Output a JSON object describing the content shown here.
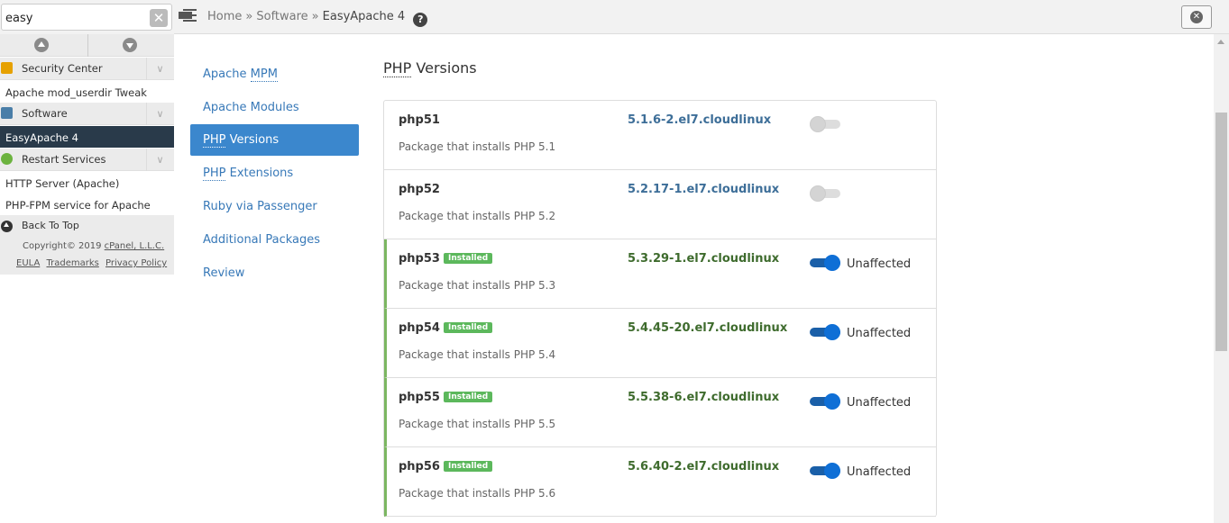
{
  "sidebar": {
    "search": {
      "value": "easy",
      "placeholder": ""
    },
    "categories": [
      {
        "label": "Security Center",
        "icon": "lock-icon"
      },
      {
        "label": "Software",
        "icon": "software-icon"
      },
      {
        "label": "Restart Services",
        "icon": "restart-icon"
      }
    ],
    "items": [
      {
        "label": "Apache mod_userdir Tweak"
      },
      {
        "label": "EasyApache 4"
      },
      {
        "label": "HTTP Server (Apache)"
      },
      {
        "label": "PHP-FPM service for Apache"
      }
    ],
    "back_to_top": "Back To Top",
    "footer": {
      "copyright": "Copyright© 2019 ",
      "company": "cPanel, L.L.C.",
      "links": [
        "EULA",
        "Trademarks",
        "Privacy Policy"
      ]
    }
  },
  "topbar": {
    "breadcrumb": [
      "Home",
      "Software",
      "EasyApache 4"
    ],
    "separator": "»",
    "help": "?"
  },
  "nav": {
    "items": [
      {
        "abbr": "Apache ",
        "abbr_part": "MPM",
        "rest": ""
      },
      {
        "label": "Apache Modules"
      },
      {
        "abbr_part": "PHP",
        "rest": " Versions"
      },
      {
        "abbr_part": "PHP",
        "rest": " Extensions"
      },
      {
        "label": "Ruby via Passenger"
      },
      {
        "label": "Additional Packages"
      },
      {
        "label": "Review"
      }
    ],
    "active_index": 2
  },
  "main": {
    "title_abbr": "PHP",
    "title_rest": " Versions",
    "installed_badge": "Installed",
    "packages": [
      {
        "name": "php51",
        "version": "5.1.6-2.el7.cloudlinux",
        "description": "Package that installs PHP 5.1",
        "installed": false,
        "enabled": false,
        "status": ""
      },
      {
        "name": "php52",
        "version": "5.2.17-1.el7.cloudlinux",
        "description": "Package that installs PHP 5.2",
        "installed": false,
        "enabled": false,
        "status": ""
      },
      {
        "name": "php53",
        "version": "5.3.29-1.el7.cloudlinux",
        "description": "Package that installs PHP 5.3",
        "installed": true,
        "enabled": true,
        "status": "Unaffected"
      },
      {
        "name": "php54",
        "version": "5.4.45-20.el7.cloudlinux",
        "description": "Package that installs PHP 5.4",
        "installed": true,
        "enabled": true,
        "status": "Unaffected"
      },
      {
        "name": "php55",
        "version": "5.5.38-6.el7.cloudlinux",
        "description": "Package that installs PHP 5.5",
        "installed": true,
        "enabled": true,
        "status": "Unaffected"
      },
      {
        "name": "php56",
        "version": "5.6.40-2.el7.cloudlinux",
        "description": "Package that installs PHP 5.6",
        "installed": true,
        "enabled": true,
        "status": "Unaffected"
      }
    ]
  },
  "colors": {
    "accent": "#3b87cd",
    "installed_green": "#5cb85c",
    "sidebar_active": "#293a4a",
    "toggle_on": "#0f6fd6"
  }
}
